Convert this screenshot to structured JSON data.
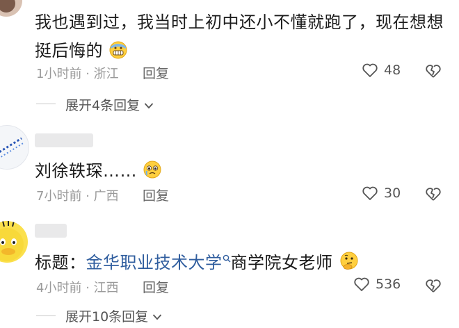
{
  "comments": [
    {
      "text": "我也遇到过，我当时上初中还小不懂就跑了，现在想想",
      "text_line2": "挺后悔的",
      "emoji": "grimacing-sweat-emoji",
      "time": "1小时前",
      "location": "浙江",
      "reply_label": "回复",
      "likes": "48",
      "expand_label": "展开4条回复"
    },
    {
      "text": "刘徐轶琛……",
      "emoji": "pleading-tears-emoji",
      "time": "7小时前",
      "location": "广西",
      "reply_label": "回复",
      "likes": "30"
    },
    {
      "text_prefix": "标题：",
      "text_link": "金华职业技术大学",
      "text_suffix": "商学院女老师",
      "emoji": "thinking-emoji",
      "time": "4小时前",
      "location": "江西",
      "reply_label": "回复",
      "likes": "536",
      "expand_label": "展开10条回复"
    }
  ],
  "separator": "·",
  "colors": {
    "link": "#2f5d9e",
    "meta": "#9a9a9a",
    "text": "#1b1b1b"
  }
}
